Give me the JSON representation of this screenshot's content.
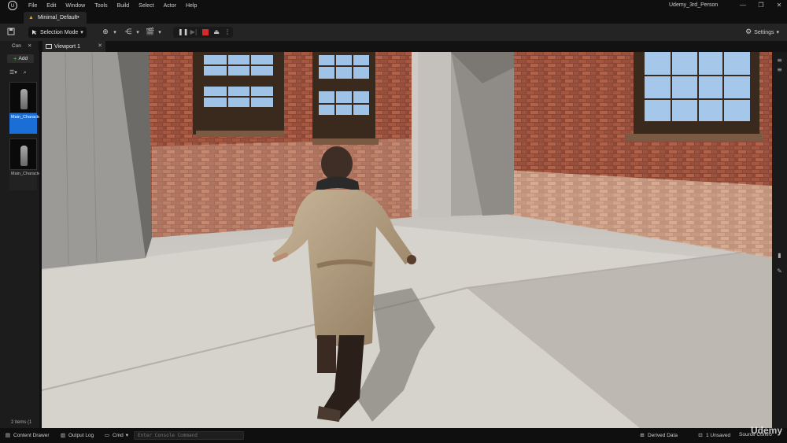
{
  "menubar": {
    "logo": "U",
    "items": [
      "File",
      "Edit",
      "Window",
      "Tools",
      "Build",
      "Select",
      "Actor",
      "Help"
    ],
    "project": "Udemy_3rd_Person",
    "window_controls": [
      "—",
      "❐",
      "✕"
    ]
  },
  "tabs": {
    "level_tab": "Minimal_Default•"
  },
  "toolbar": {
    "save_icon": "floppy-icon",
    "mode_label": "Selection Mode",
    "settings_label": "Settings",
    "accent_stop": "#d62a2a"
  },
  "content_browser": {
    "tab_label": "Con",
    "add_label": "Add",
    "assets": [
      {
        "label": "Main_Character_..."
      },
      {
        "label": "Main_Character_ABP"
      }
    ],
    "items_count": "2 items (1"
  },
  "viewport": {
    "tab_label": "Viewport 1"
  },
  "statusbar": {
    "content_drawer": "Content Drawer",
    "output_log": "Output Log",
    "cmd": "Cmd",
    "console_placeholder": "Enter Console Command",
    "derived_data": "Derived Data",
    "unsaved": "1 Unsaved",
    "source_control": "Source Contro"
  },
  "watermark": "Udemy"
}
